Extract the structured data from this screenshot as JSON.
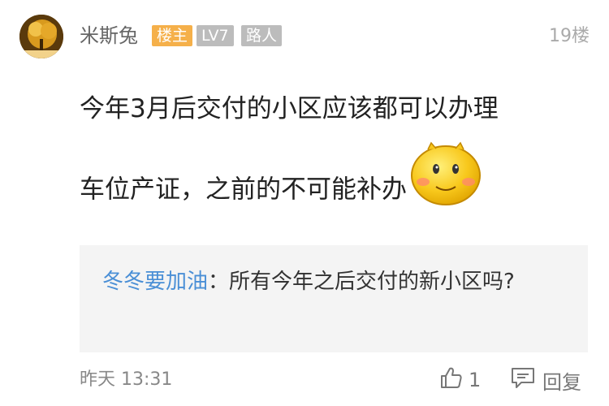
{
  "post": {
    "username": "米斯兔",
    "badges": {
      "host": "楼主",
      "level": "LV7",
      "rank": "路人"
    },
    "floor": "19楼",
    "content_lines": [
      "今年3月后交付的小区应该都可以办理",
      "车位产证，之前的不可能补办"
    ],
    "emoji": "smiley-blush-emoji"
  },
  "quote": {
    "user": "冬冬要加油",
    "separator": "：",
    "text": "所有今年之后交付的新小区吗?"
  },
  "footer": {
    "time": "昨天 13:31",
    "like_count": "1",
    "reply_label": "回复"
  },
  "colors": {
    "host_badge": "#f5b04a",
    "gray_badge": "#bcbcbc",
    "quote_user": "#4a8fd6",
    "quote_bg": "#f4f4f4"
  }
}
